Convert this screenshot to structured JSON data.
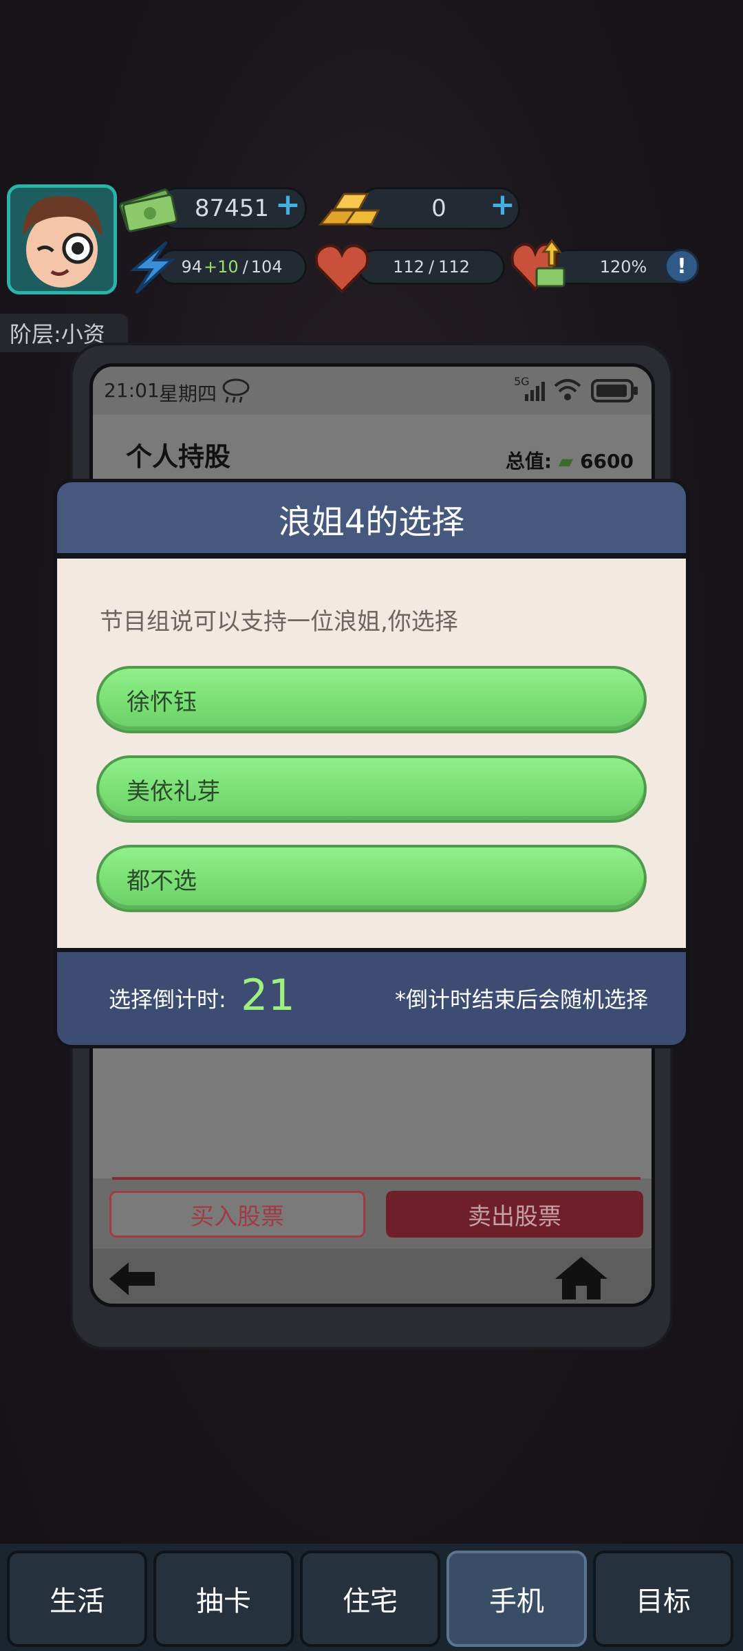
{
  "hud": {
    "cash": "87451",
    "gold": "0",
    "energy_base": "94",
    "energy_bonus": "+10",
    "energy_max": "104",
    "health_current": "112",
    "health_max": "112",
    "income_rate": "120%",
    "tier_label": "阶层:小资"
  },
  "phone": {
    "time": "21:01",
    "weekday": "星期四",
    "network": "5G",
    "page_title": "个人持股",
    "total_label": "总值:",
    "total_value": "6600",
    "buy_label": "买入股票",
    "sell_label": "卖出股票"
  },
  "modal": {
    "title": "浪姐4的选择",
    "prompt": "节目组说可以支持一位浪姐,你选择",
    "options": [
      "徐怀钰",
      "美依礼芽",
      "都不选"
    ],
    "countdown_label": "选择倒计时:",
    "countdown_value": "21",
    "note": "*倒计时结束后会随机选择"
  },
  "tabs": [
    {
      "label": "生活",
      "active": false
    },
    {
      "label": "抽卡",
      "active": false
    },
    {
      "label": "住宅",
      "active": false
    },
    {
      "label": "手机",
      "active": true
    },
    {
      "label": "目标",
      "active": false
    }
  ],
  "colors": {
    "modal_header": "#46587e",
    "modal_footer": "#3c4c72",
    "option_green": "#7fe37a",
    "countdown_green": "#9ff07e",
    "tab_active": "#3a4d66"
  }
}
